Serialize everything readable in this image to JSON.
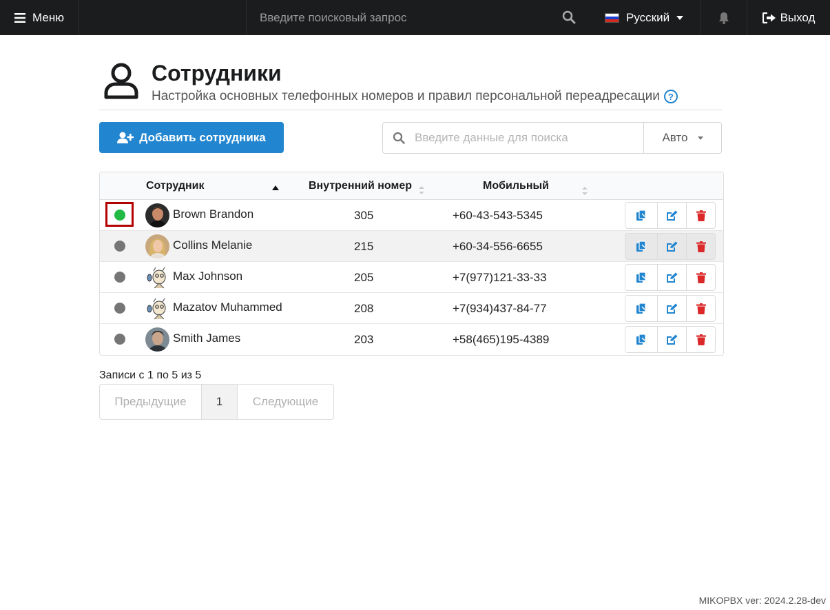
{
  "topbar": {
    "menu_label": "Меню",
    "search_placeholder": "Введите поисковый запрос",
    "language": "Русский",
    "logout_label": "Выход"
  },
  "header": {
    "title": "Сотрудники",
    "subtitle": "Настройка основных телефонных номеров и правил персональной переадресации"
  },
  "toolbar": {
    "add_label": "Добавить сотрудника",
    "search_placeholder": "Введите данные для поиска",
    "page_size": "Авто"
  },
  "table": {
    "columns": [
      "Сотрудник",
      "Внутренний номер",
      "Мобильный"
    ],
    "rows": [
      {
        "status": "online",
        "name": "Brown Brandon",
        "ext": "305",
        "mobile": "+60-43-543-5345"
      },
      {
        "status": "offline",
        "name": "Collins Melanie",
        "ext": "215",
        "mobile": "+60-34-556-6655"
      },
      {
        "status": "offline",
        "name": "Max Johnson",
        "ext": "205",
        "mobile": "+7(977)121-33-33"
      },
      {
        "status": "offline",
        "name": "Mazatov Muhammed",
        "ext": "208",
        "mobile": "+7(934)437-84-77"
      },
      {
        "status": "offline",
        "name": "Smith James",
        "ext": "203",
        "mobile": "+58(465)195-4389"
      }
    ]
  },
  "pagination": {
    "info": "Записи с 1 по 5 из 5",
    "prev_label": "Предыдущие",
    "current_page": "1",
    "next_label": "Следующие"
  },
  "footer": {
    "version": "MIKOPBX ver: 2024.2.28-dev"
  },
  "colors": {
    "primary": "#2185d0",
    "online": "#21ba45",
    "offline": "#767676",
    "delete": "#db2828",
    "topbar": "#1b1c1d"
  }
}
